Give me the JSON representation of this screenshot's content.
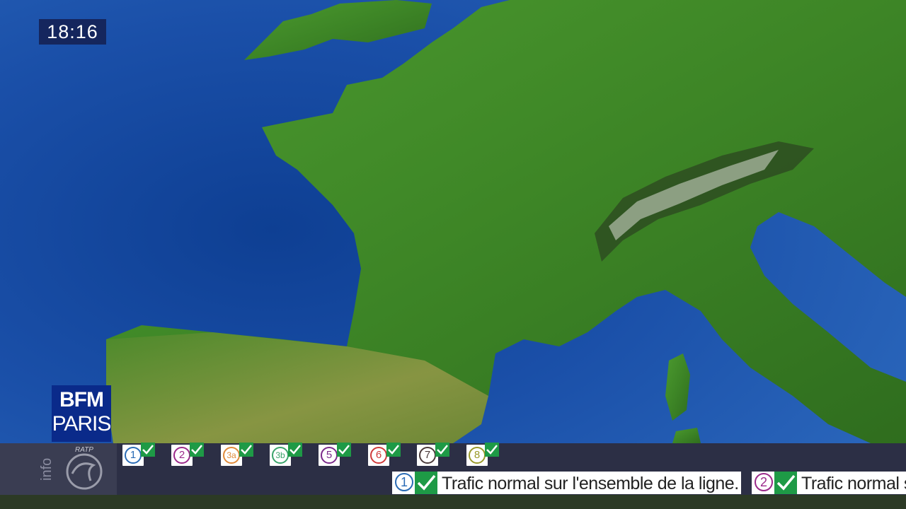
{
  "clock": {
    "time": "18:16"
  },
  "logo": {
    "line1": "BFM",
    "line2": "PARIS"
  },
  "sidebar": {
    "info_label": "info",
    "ratp_label": "RATP"
  },
  "colors": {
    "sea": "#1a4fa8",
    "land": "#3f8a2a",
    "bar": "#2c2f45",
    "check": "#1e9a46",
    "logo": "#0a2a8a"
  },
  "metro_lines": [
    {
      "label": "1",
      "color": "#2a6bb5",
      "status_icon": "check-icon"
    },
    {
      "label": "2",
      "color": "#9b2a8a",
      "status_icon": "check-icon"
    },
    {
      "label": "3a",
      "color": "#e08a3a",
      "status_icon": "check-icon"
    },
    {
      "label": "3b",
      "color": "#3aa36a",
      "status_icon": "check-icon"
    },
    {
      "label": "5",
      "color": "#7a2a8a",
      "status_icon": "check-icon"
    },
    {
      "label": "6",
      "color": "#d03a3a",
      "status_icon": "check-icon"
    },
    {
      "label": "7",
      "color": "#4a3a3a",
      "status_icon": "check-icon"
    },
    {
      "label": "8",
      "color": "#9a9a2a",
      "status_icon": "check-icon"
    }
  ],
  "ticker": [
    {
      "line": "1",
      "color": "#2a6bb5",
      "text": "Trafic normal sur l'ensemble de la ligne."
    },
    {
      "line": "2",
      "color": "#9b2a8a",
      "text": "Trafic normal s"
    }
  ]
}
